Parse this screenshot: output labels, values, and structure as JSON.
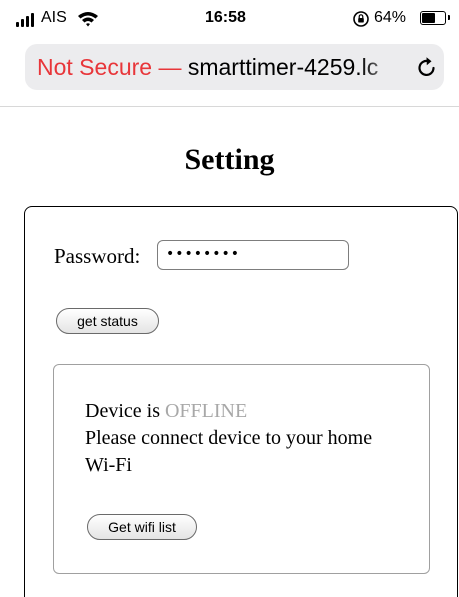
{
  "status_bar": {
    "carrier": "AIS",
    "time": "16:58",
    "battery_percent": "64%",
    "battery_level": 0.64,
    "icons": [
      "signal-icon",
      "wifi-icon",
      "rotation-lock-icon",
      "battery-icon"
    ]
  },
  "address_bar": {
    "security_label": "Not Secure —",
    "domain": "smarttimer-4259.lc",
    "reload_icon": "reload-icon"
  },
  "page": {
    "title": "Setting",
    "password_label": "Password:",
    "password_value": "••••••••",
    "get_status_button": "get status",
    "device_status_prefix": "Device is",
    "device_status_value": "OFFLINE",
    "message": "Please connect device to your home Wi-Fi",
    "wifi_list_button": "Get wifi list"
  },
  "colors": {
    "not_secure": "#e8363a",
    "offline": "#a8a8a8",
    "address_bar_bg": "#ececee"
  }
}
